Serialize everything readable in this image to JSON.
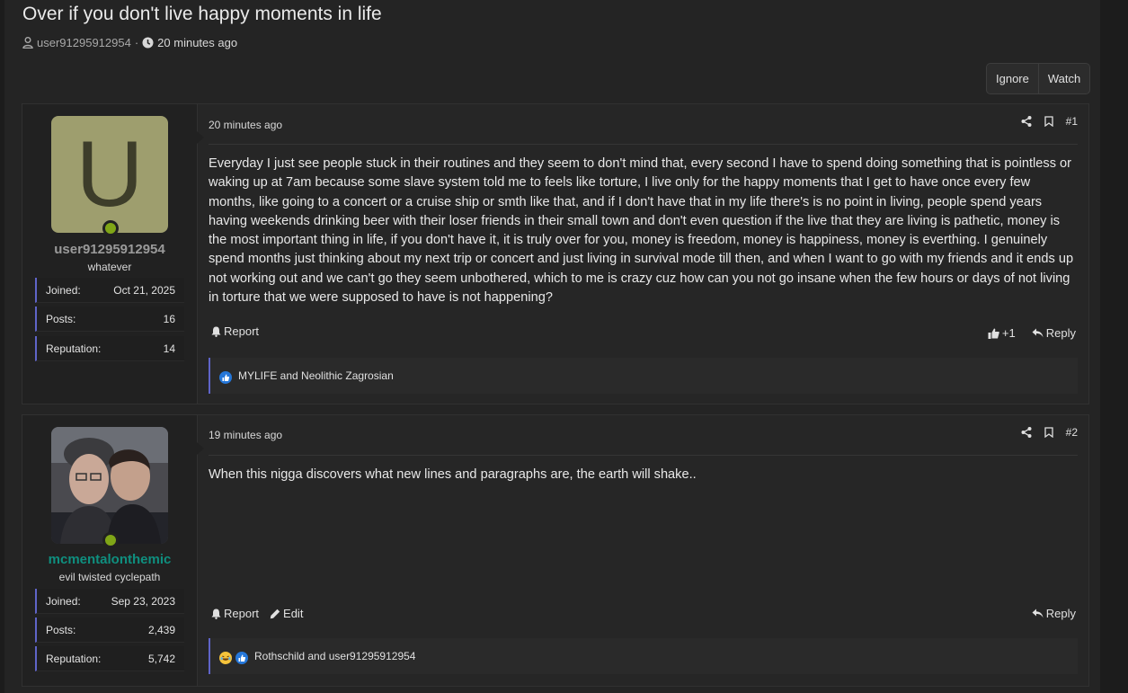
{
  "thread": {
    "title": "Over if you don't live happy moments in life",
    "author": "user91295912954",
    "separator": "·",
    "time": "20 minutes ago"
  },
  "actions": {
    "ignore": "Ignore",
    "watch": "Watch"
  },
  "posts": [
    {
      "avatar_letter": "U",
      "username": "user91295912954",
      "user_title": "whatever",
      "stats": [
        {
          "label": "Joined:",
          "value": "Oct 21, 2025"
        },
        {
          "label": "Posts:",
          "value": "16"
        },
        {
          "label": "Reputation:",
          "value": "14"
        }
      ],
      "date": "20 minutes ago",
      "number": "#1",
      "body": "Everyday I just see people stuck in their routines and they seem to don't mind that, every second I have to spend doing something that is pointless or waking up at 7am because some slave system told me to feels like torture, I live only for the happy moments that I get to have once every few months, like going to a concert or a cruise ship or smth like that, and if I don't have that in my life there's is no point in living, people spend years having weekends drinking beer with their loser friends in their small town and don't even question if the live that they are living is pathetic, money is the most important thing in life, if you don't have it, it is truly over for you, money is freedom, money is happiness, money is everthing. I genuinely spend months just thinking about my next trip or concert and just living in survival mode till then, and when I want to go with my friends and it ends up not working out and we can't go they seem unbothered, which to me is crazy cuz how can you not go insane when the few hours or days of not living in torture that we were supposed to have is not happening?",
      "report": "Report",
      "like_count": "+1",
      "reply": "Reply",
      "reactions_text": "MYLIFE and Neolithic Zagrosian"
    },
    {
      "username": "mcmentalonthemic",
      "user_title": "evil twisted cyclepath",
      "stats": [
        {
          "label": "Joined:",
          "value": "Sep 23, 2023"
        },
        {
          "label": "Posts:",
          "value": "2,439"
        },
        {
          "label": "Reputation:",
          "value": "5,742"
        }
      ],
      "date": "19 minutes ago",
      "number": "#2",
      "body": "When this nigga discovers what new lines and paragraphs are, the earth will shake..",
      "report": "Report",
      "edit": "Edit",
      "reply": "Reply",
      "reactions_text": "Rothschild and user91295912954"
    }
  ],
  "colors": {
    "background": "#242424",
    "accent_border": "#5f64c8",
    "online": "#80a617",
    "username_teal": "#0f8f7f",
    "avatar_bg": "#9e9e6e"
  },
  "icons": [
    "user-icon",
    "clock-icon",
    "share-icon",
    "bookmark-icon",
    "bell-icon",
    "thumbs-up-icon",
    "reply-icon",
    "pencil-icon",
    "like-reaction-icon",
    "laugh-reaction-icon"
  ]
}
